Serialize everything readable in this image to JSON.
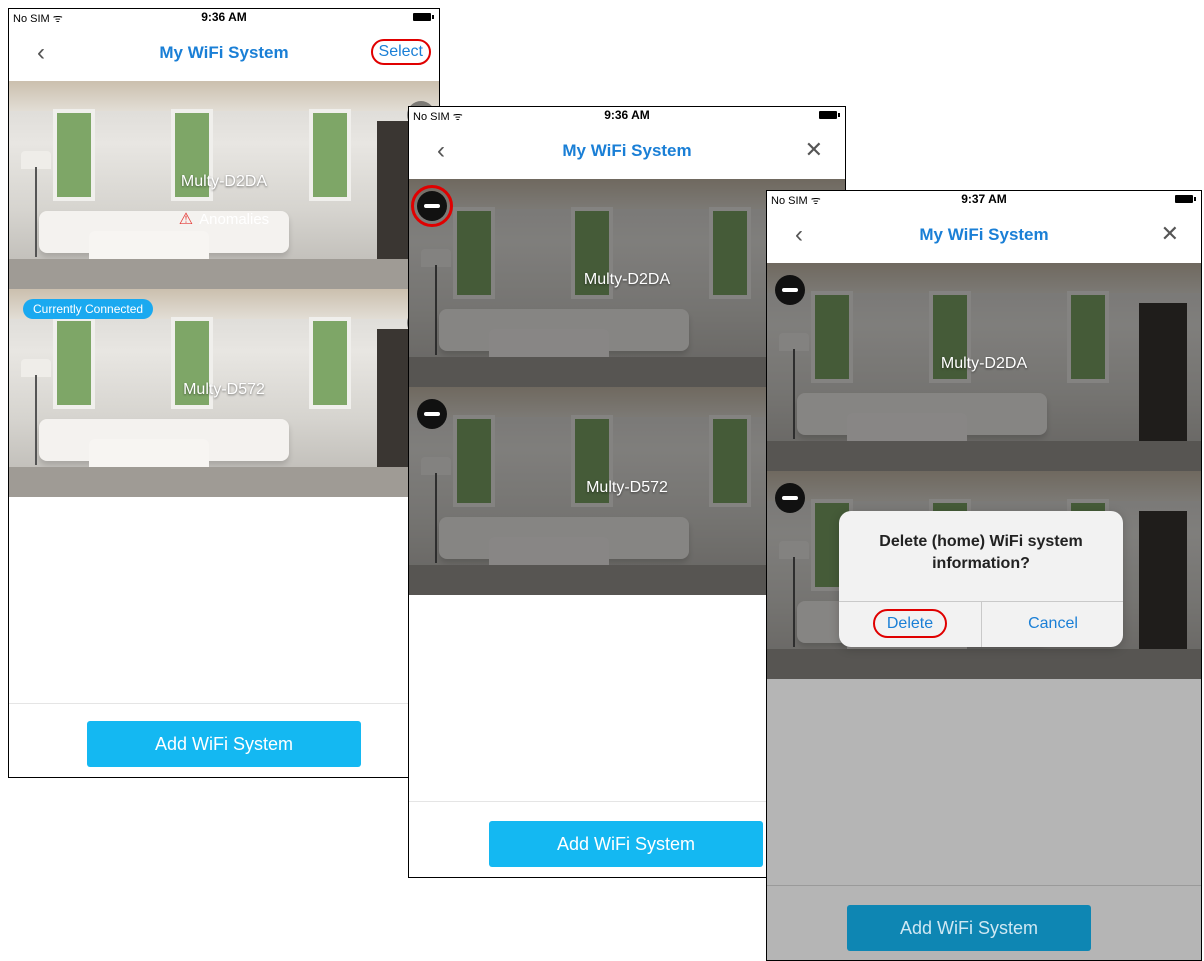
{
  "screen1": {
    "status": {
      "carrier": "No SIM ᯤ",
      "time": "9:36 AM"
    },
    "title": "My WiFi System",
    "select_label": "Select",
    "systems": [
      {
        "name": "Multy-D2DA",
        "status": "Anomalies"
      },
      {
        "name": "Multy-D572",
        "badge": "Currently Connected"
      }
    ],
    "add_label": "Add WiFi System"
  },
  "screen2": {
    "status": {
      "carrier": "No SIM ᯤ",
      "time": "9:36 AM"
    },
    "title": "My WiFi System",
    "systems": [
      {
        "name": "Multy-D2DA"
      },
      {
        "name": "Multy-D572"
      }
    ],
    "add_label": "Add WiFi System"
  },
  "screen3": {
    "status": {
      "carrier": "No SIM ᯤ",
      "time": "9:37 AM"
    },
    "title": "My WiFi System",
    "systems": [
      {
        "name": "Multy-D2DA"
      }
    ],
    "dialog": {
      "message": "Delete (home) WiFi system information?",
      "delete_label": "Delete",
      "cancel_label": "Cancel"
    },
    "add_label": "Add WiFi System"
  },
  "icons": {
    "back": "chevron-left-icon",
    "close": "close-icon",
    "edit": "edit-icon",
    "camera": "camera-icon",
    "warning": "warning-icon",
    "delete": "minus-circle-icon"
  },
  "colors": {
    "accent": "#1a7fd6",
    "button": "#14b8f2",
    "highlight": "#e00000"
  }
}
